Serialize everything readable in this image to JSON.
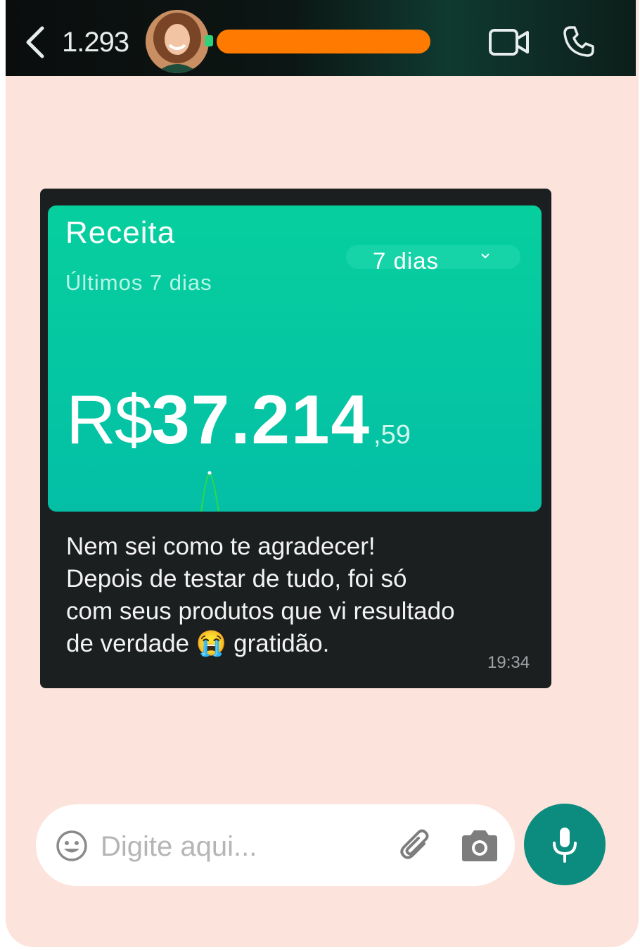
{
  "header": {
    "unread_count": "1.293",
    "online_color": "#2fd17b",
    "name_redaction_color": "#ff7a00",
    "icons": [
      "back-icon",
      "video-icon",
      "phone-icon"
    ]
  },
  "card": {
    "title": "Receita",
    "subtitle": "Últimos 7 dias",
    "period_selected": "7 dias",
    "currency": "R$",
    "amount_integer": "37.214",
    "amount_decimal": ",59",
    "accent_color": "#06cf9e"
  },
  "message": {
    "text": "Nem sei como te agradecer!\nDepois de testar de tudo, foi só\ncom seus produtos que vi resultado\nde verdade 😭 gratidão.",
    "time": "19:34"
  },
  "composer": {
    "placeholder": "Digite aqui...",
    "mic_color": "#0b8c7f",
    "icons": [
      "emoji-icon",
      "paperclip-icon",
      "camera-icon",
      "mic-icon"
    ]
  }
}
